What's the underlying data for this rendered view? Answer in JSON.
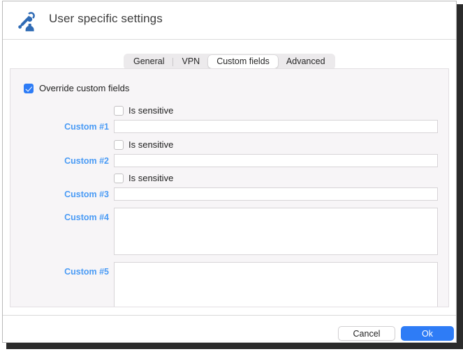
{
  "window": {
    "title": "User specific settings",
    "icon": "user-key-icon"
  },
  "tabs": [
    {
      "label": "General",
      "selected": false
    },
    {
      "label": "VPN",
      "selected": false
    },
    {
      "label": "Custom fields",
      "selected": true
    },
    {
      "label": "Advanced",
      "selected": false
    }
  ],
  "override": {
    "label": "Override custom fields",
    "checked": true
  },
  "sensitive_label": "Is sensitive",
  "sensitive_rows": [
    {
      "label": "Is sensitive",
      "checked": false
    },
    {
      "label": "Is sensitive",
      "checked": false
    },
    {
      "label": "Is sensitive",
      "checked": false
    }
  ],
  "fields": [
    {
      "label": "Custom #1",
      "value": "",
      "type": "input"
    },
    {
      "label": "Custom #2",
      "value": "",
      "type": "input"
    },
    {
      "label": "Custom #3",
      "value": "",
      "type": "input"
    },
    {
      "label": "Custom #4",
      "value": "",
      "type": "textarea"
    },
    {
      "label": "Custom #5",
      "value": "",
      "type": "textarea"
    }
  ],
  "footer": {
    "cancel_label": "Cancel",
    "ok_label": "Ok"
  },
  "colors": {
    "accent": "#2e7cf6",
    "link": "#4a9bf5",
    "panel_bg": "#f7f5f7",
    "window_bg": "#ffffff"
  }
}
